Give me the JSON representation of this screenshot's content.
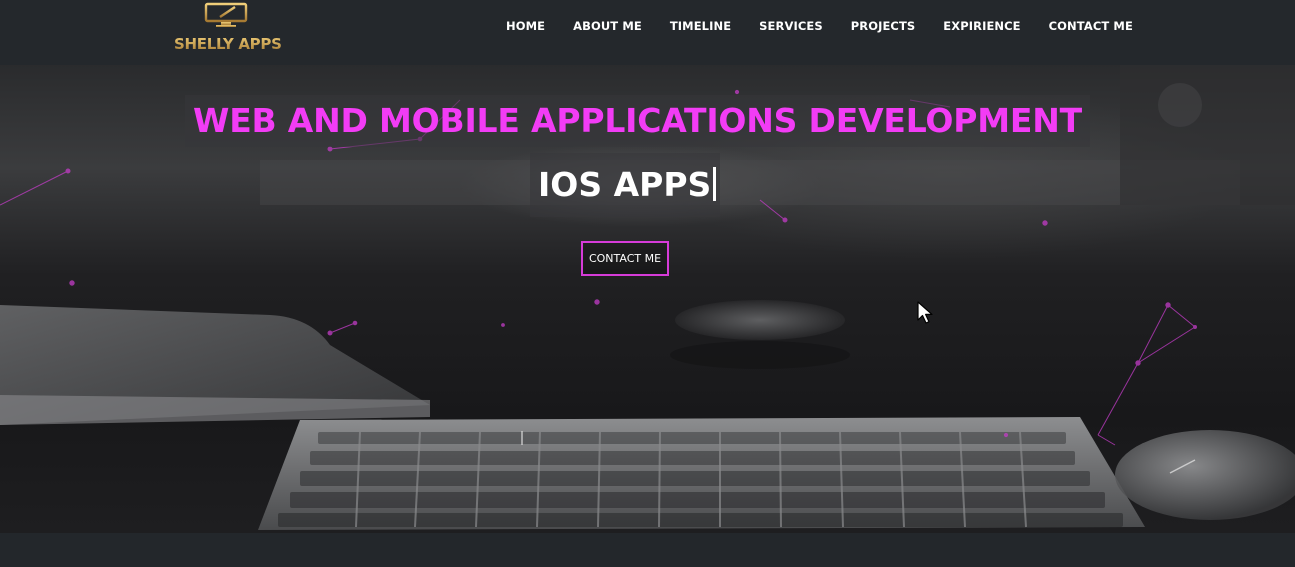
{
  "brand": {
    "name": "SHELLY APPS",
    "icon": "monitor-pen-icon",
    "gold": "#c99a45"
  },
  "nav": {
    "items": [
      {
        "label": "HOME"
      },
      {
        "label": "ABOUT ME"
      },
      {
        "label": "TIMELINE"
      },
      {
        "label": "SERVICES"
      },
      {
        "label": "PROJECTS"
      },
      {
        "label": "EXPIRIENCE"
      },
      {
        "label": "CONTACT ME"
      }
    ]
  },
  "hero": {
    "headline": "WEB AND MOBILE APPLICATIONS DEVELOPMENT",
    "typed_text": "IOS APPS",
    "cta_label": "CONTACT ME",
    "accent": "#f23cf5"
  },
  "colors": {
    "navbar": "#24282c",
    "button_border": "#d63bd8",
    "particle": "#c43cc8"
  }
}
